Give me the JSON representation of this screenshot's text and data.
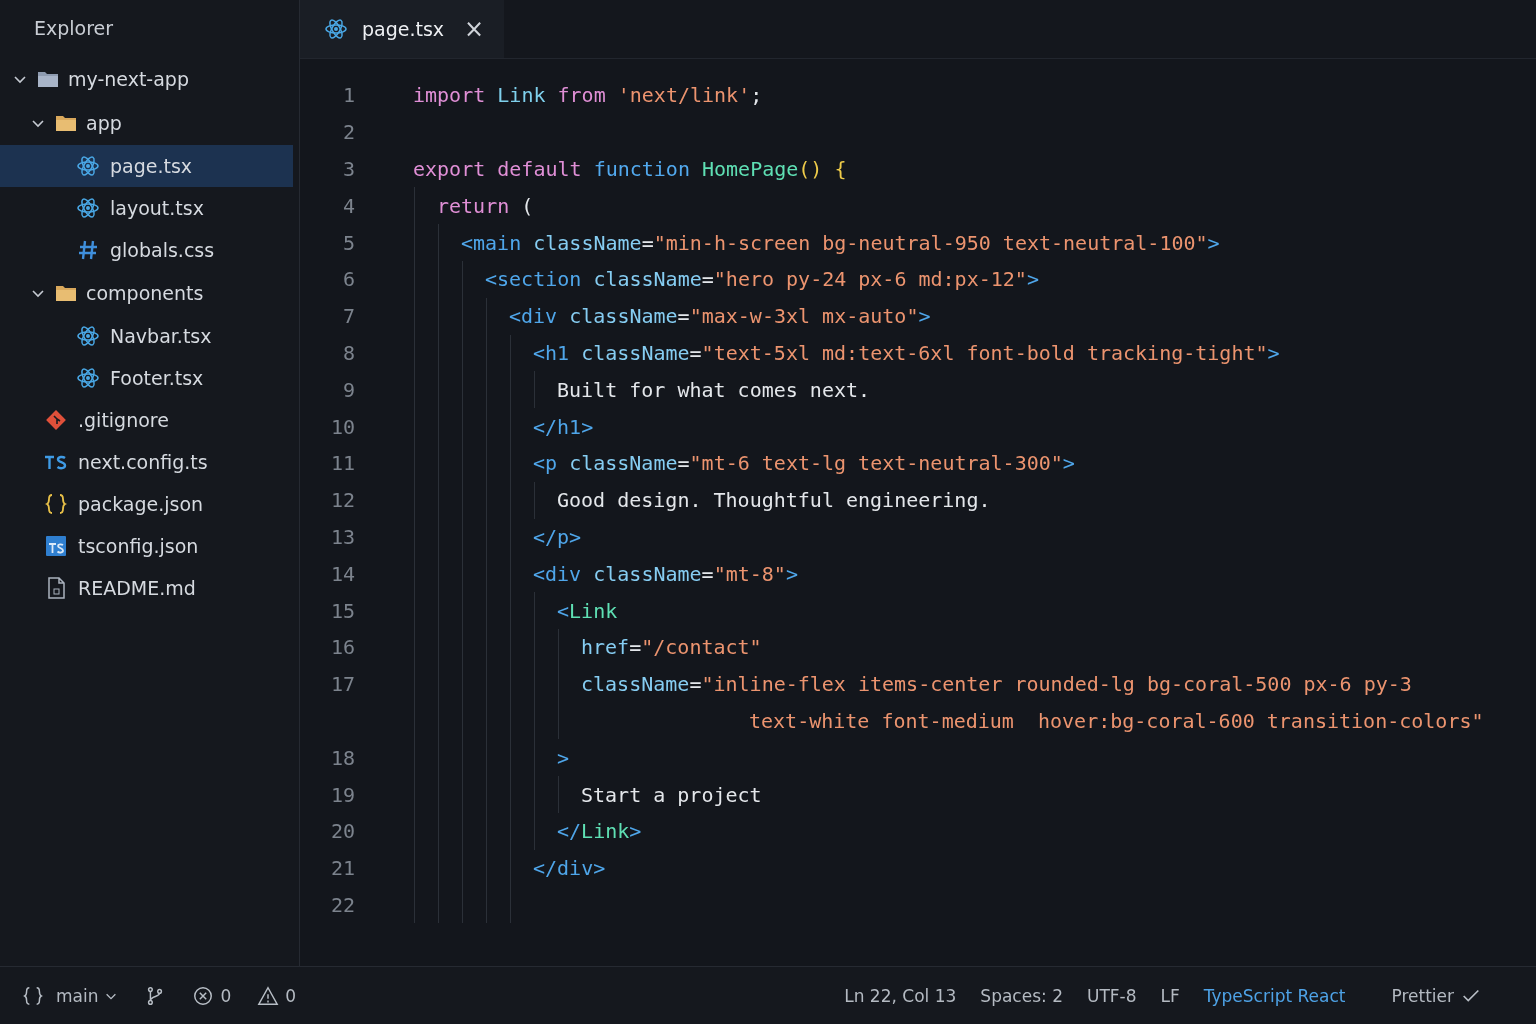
{
  "sidebar": {
    "title": "Explorer",
    "tree": [
      {
        "name": "my-next-app",
        "kind": "root-folder",
        "expanded": true,
        "selected": false,
        "children": [
          {
            "name": "app",
            "kind": "folder",
            "expanded": true,
            "selected": false,
            "children": [
              {
                "name": "page.tsx",
                "kind": "react",
                "selected": true
              },
              {
                "name": "layout.tsx",
                "kind": "react",
                "selected": false
              },
              {
                "name": "globals.css",
                "kind": "css",
                "selected": false
              }
            ]
          },
          {
            "name": "components",
            "kind": "folder",
            "expanded": true,
            "selected": false,
            "children": [
              {
                "name": "Navbar.tsx",
                "kind": "react",
                "selected": false
              },
              {
                "name": "Footer.tsx",
                "kind": "react",
                "selected": false
              }
            ]
          },
          {
            "name": ".gitignore",
            "kind": "git",
            "selected": false
          },
          {
            "name": "next.config.ts",
            "kind": "ts",
            "selected": false
          },
          {
            "name": "package.json",
            "kind": "json",
            "selected": false
          },
          {
            "name": "tsconfig.json",
            "kind": "tsconfig",
            "selected": false
          },
          {
            "name": "README.md",
            "kind": "file",
            "selected": false
          }
        ]
      }
    ]
  },
  "tabs": [
    {
      "label": "page.tsx",
      "kind": "react",
      "selected": true,
      "close": "×"
    }
  ],
  "editor": {
    "lines": [
      {
        "number": "1",
        "tokens": [
          {
            "kind": "k",
            "text": "import "
          },
          {
            "kind": "i",
            "text": "Link "
          },
          {
            "kind": "k",
            "text": "from "
          },
          {
            "kind": "s",
            "text": "'next/link'"
          },
          {
            "kind": "p",
            "text": ";"
          }
        ]
      },
      {
        "number": "2"
      },
      {
        "number": "3",
        "tokens": [
          {
            "kind": "k",
            "text": "export default "
          },
          {
            "kind": "f",
            "text": "function "
          },
          {
            "kind": "n",
            "text": "HomePage"
          },
          {
            "kind": "b",
            "text": "() {"
          }
        ],
        "children": [
          {
            "number": "4",
            "tokens": [
              {
                "kind": "k",
                "text": "return"
              },
              {
                "kind": "p",
                "text": " ("
              }
            ],
            "children": [
              {
                "number": "5",
                "tokens": [
                  {
                    "kind": "t",
                    "text": "<main "
                  },
                  {
                    "kind": "a",
                    "text": "className"
                  },
                  {
                    "kind": "p",
                    "text": "="
                  },
                  {
                    "kind": "s",
                    "text": "\"min-h-screen bg-neutral-950 text-neutral-100\""
                  },
                  {
                    "kind": "t",
                    "text": ">"
                  }
                ],
                "children": [
                  {
                    "number": "6",
                    "tokens": [
                      {
                        "kind": "t",
                        "text": "<section "
                      },
                      {
                        "kind": "a",
                        "text": "className"
                      },
                      {
                        "kind": "p",
                        "text": "="
                      },
                      {
                        "kind": "s",
                        "text": "\"hero py-24 px-6 md:px-12\""
                      },
                      {
                        "kind": "t",
                        "text": ">"
                      }
                    ],
                    "children": [
                      {
                        "number": "7",
                        "tokens": [
                          {
                            "kind": "t",
                            "text": "<div "
                          },
                          {
                            "kind": "a",
                            "text": "className"
                          },
                          {
                            "kind": "p",
                            "text": "="
                          },
                          {
                            "kind": "s",
                            "text": "\"max-w-3xl mx-auto\""
                          },
                          {
                            "kind": "t",
                            "text": ">"
                          }
                        ],
                        "children": [
                          {
                            "number": "8",
                            "tokens": [
                              {
                                "kind": "t",
                                "text": "<h1 "
                              },
                              {
                                "kind": "a",
                                "text": "className"
                              },
                              {
                                "kind": "p",
                                "text": "="
                              },
                              {
                                "kind": "s",
                                "text": "\"text-5xl md:text-6xl font-bold tracking-tight\""
                              },
                              {
                                "kind": "t",
                                "text": ">"
                              }
                            ],
                            "children": [
                              {
                                "number": "9",
                                "tokens": [
                                  {
                                    "kind": "p",
                                    "text": "Built for what comes next."
                                  }
                                ]
                              }
                            ]
                          },
                          {
                            "number": "10",
                            "tokens": [
                              {
                                "kind": "t",
                                "text": "</h1>"
                              }
                            ]
                          },
                          {
                            "number": "11",
                            "tokens": [
                              {
                                "kind": "t",
                                "text": "<p "
                              },
                              {
                                "kind": "a",
                                "text": "className"
                              },
                              {
                                "kind": "p",
                                "text": "="
                              },
                              {
                                "kind": "s",
                                "text": "\"mt-6 text-lg text-neutral-300\""
                              },
                              {
                                "kind": "t",
                                "text": ">"
                              }
                            ],
                            "children": [
                              {
                                "number": "12",
                                "tokens": [
                                  {
                                    "kind": "p",
                                    "text": "Good design. Thoughtful engineering."
                                  }
                                ]
                              }
                            ]
                          },
                          {
                            "number": "13",
                            "tokens": [
                              {
                                "kind": "t",
                                "text": "</p>"
                              }
                            ]
                          },
                          {
                            "number": "14",
                            "tokens": [
                              {
                                "kind": "t",
                                "text": "<div "
                              },
                              {
                                "kind": "a",
                                "text": "className"
                              },
                              {
                                "kind": "p",
                                "text": "="
                              },
                              {
                                "kind": "s",
                                "text": "\"mt-8\""
                              },
                              {
                                "kind": "t",
                                "text": ">"
                              }
                            ],
                            "children": [
                              {
                                "number": "15",
                                "tokens": [
                                  {
                                    "kind": "t",
                                    "text": "<"
                                  },
                                  {
                                    "kind": "n",
                                    "text": "Link"
                                  }
                                ],
                                "children": [
                                  {
                                    "number": "16",
                                    "tokens": [
                                      {
                                        "kind": "a",
                                        "text": "href"
                                      },
                                      {
                                        "kind": "p",
                                        "text": "="
                                      },
                                      {
                                        "kind": "s",
                                        "text": "\"/contact\""
                                      }
                                    ]
                                  },
                                  {
                                    "number": "17",
                                    "tokens": [
                                      {
                                        "kind": "a",
                                        "text": "className"
                                      },
                                      {
                                        "kind": "p",
                                        "text": "="
                                      },
                                      {
                                        "kind": "s",
                                        "text": "\"inline-flex items-center rounded-lg bg-coral-500 px-6 py-3"
                                      }
                                    ],
                                    "wrap_tokens": [
                                      {
                                        "kind": "s",
                                        "text": "text-white font-medium  hover:bg-coral-600 transition-colors\""
                                      }
                                    ]
                                  }
                                ]
                              },
                              {
                                "number": "18",
                                "tokens": [
                                  {
                                    "kind": "t",
                                    "text": ">"
                                  }
                                ],
                                "children": [
                                  {
                                    "number": "19",
                                    "tokens": [
                                      {
                                        "kind": "p",
                                        "text": "Start a project"
                                      }
                                    ]
                                  }
                                ]
                              },
                              {
                                "number": "20",
                                "tokens": [
                                  {
                                    "kind": "t",
                                    "text": "</"
                                  },
                                  {
                                    "kind": "n",
                                    "text": "Link"
                                  },
                                  {
                                    "kind": "t",
                                    "text": ">"
                                  }
                                ]
                              }
                            ]
                          },
                          {
                            "number": "21",
                            "tokens": [
                              {
                                "kind": "t",
                                "text": "</div>"
                              }
                            ]
                          },
                          {
                            "number": "22"
                          }
                        ]
                      }
                    ]
                  }
                ]
              }
            ]
          }
        ]
      }
    ]
  },
  "status_bar": {
    "branch": "main",
    "errors": "0",
    "warnings": "0",
    "items": [
      {
        "text": "Ln 22, Col 13",
        "kind": "plain"
      },
      {
        "text": "Spaces: 2",
        "kind": "plain"
      },
      {
        "text": "UTF-8",
        "kind": "plain"
      },
      {
        "text": "LF",
        "kind": "plain"
      },
      {
        "text": "TypeScript React",
        "kind": "language"
      },
      {
        "text": "Prettier",
        "kind": "formatter"
      }
    ]
  }
}
